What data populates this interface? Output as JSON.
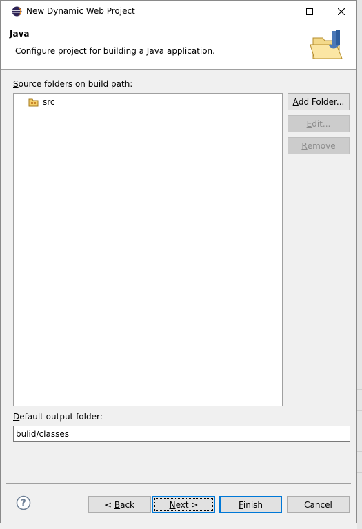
{
  "window": {
    "title": "New Dynamic Web Project",
    "controls": {
      "minimize": "minimize",
      "maximize": "maximize",
      "close": "close"
    }
  },
  "header": {
    "title": "Java",
    "description": "Configure project for building a Java application.",
    "image_icon": "java-folder-wizard-icon"
  },
  "source_folders": {
    "label_first": "S",
    "label_rest": "ource folders on build path:",
    "items": [
      {
        "label": "src",
        "icon": "package-folder-icon"
      }
    ]
  },
  "side_buttons": {
    "add_folder": {
      "first": "A",
      "rest": "dd Folder...",
      "enabled": true
    },
    "edit": {
      "first": "E",
      "rest": "dit...",
      "enabled": false
    },
    "remove": {
      "first": "R",
      "rest": "emove",
      "enabled": false
    }
  },
  "output": {
    "label_first": "D",
    "label_rest": "efault output folder:",
    "value": "bulid/classes"
  },
  "footer": {
    "help_icon": "help-icon",
    "back": {
      "prefix": "< ",
      "first": "B",
      "rest": "ack"
    },
    "next": {
      "first": "N",
      "rest": "ext >"
    },
    "finish": {
      "first": "F",
      "rest": "inish"
    },
    "cancel": "Cancel"
  },
  "colors": {
    "accent": "#0078d7",
    "dialog_bg": "#f0f0f0",
    "header_bg": "#ffffff"
  }
}
